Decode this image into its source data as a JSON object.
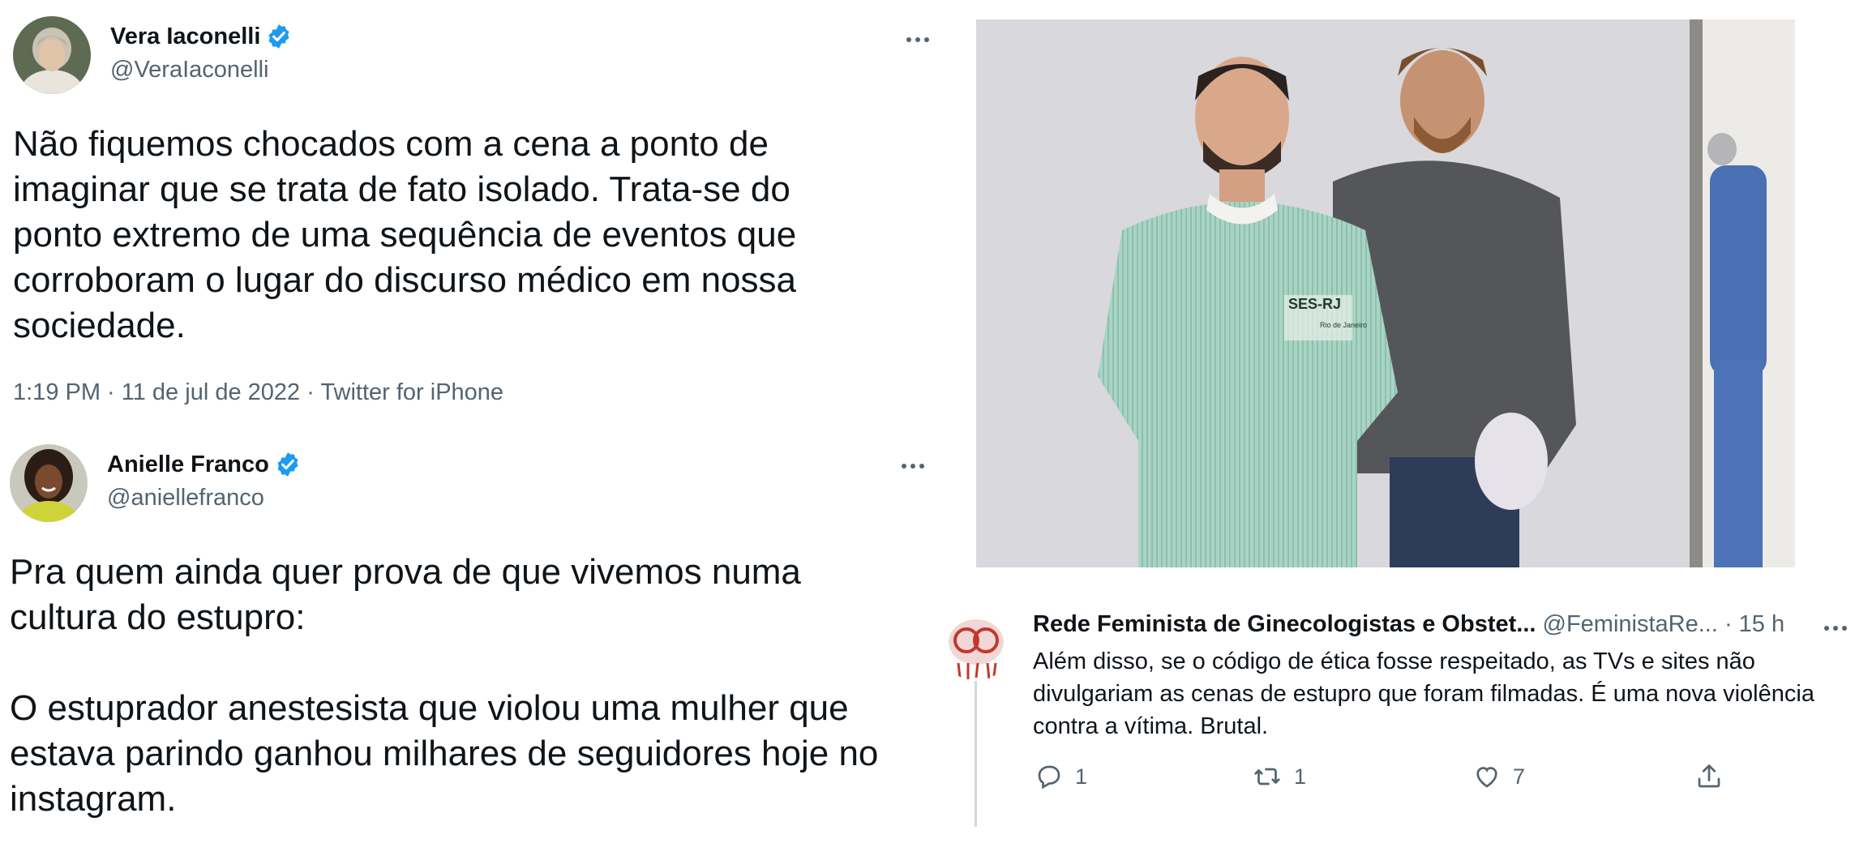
{
  "tweet1": {
    "display_name": "Vera Iaconelli",
    "handle": "@VeraIaconelli",
    "text": "Não fiquemos chocados com a cena a ponto de\nimaginar que se trata de fato isolado. Trata-se do\nponto extremo de uma sequência de eventos que\ncorroboram o lugar do discurso médico em nossa\nsociedade.",
    "meta": "1:19 PM · 11 de jul de 2022 · Twitter for iPhone"
  },
  "tweet2": {
    "display_name": "Anielle Franco",
    "handle": "@aniellefranco",
    "text": "Pra quem ainda quer prova de que vivemos numa\ncultura do estupro:\n\nO estuprador anestesista que violou uma mulher que\nestava parindo ganhou milhares de seguidores hoje no\ninstagram."
  },
  "photo": {
    "shirt_text_1": "SES-RJ",
    "shirt_text_2": "Rio de Janeiro"
  },
  "reply": {
    "display_name": "Rede Feminista de Ginecologistas e Obstet...",
    "handle_time": "@FeministaRe... · 15 h",
    "text": "Além disso, se o código de ética fosse respeitado, as TVs e sites não\ndivulgariam as cenas de estupro que foram filmadas. É uma nova violência\ncontra a vítima. Brutal.",
    "reply_count": "1",
    "retweet_count": "1",
    "like_count": "7"
  },
  "colors": {
    "verified": "#1d9bf0",
    "secondary_text": "#536471",
    "primary_text": "#0f1419"
  }
}
